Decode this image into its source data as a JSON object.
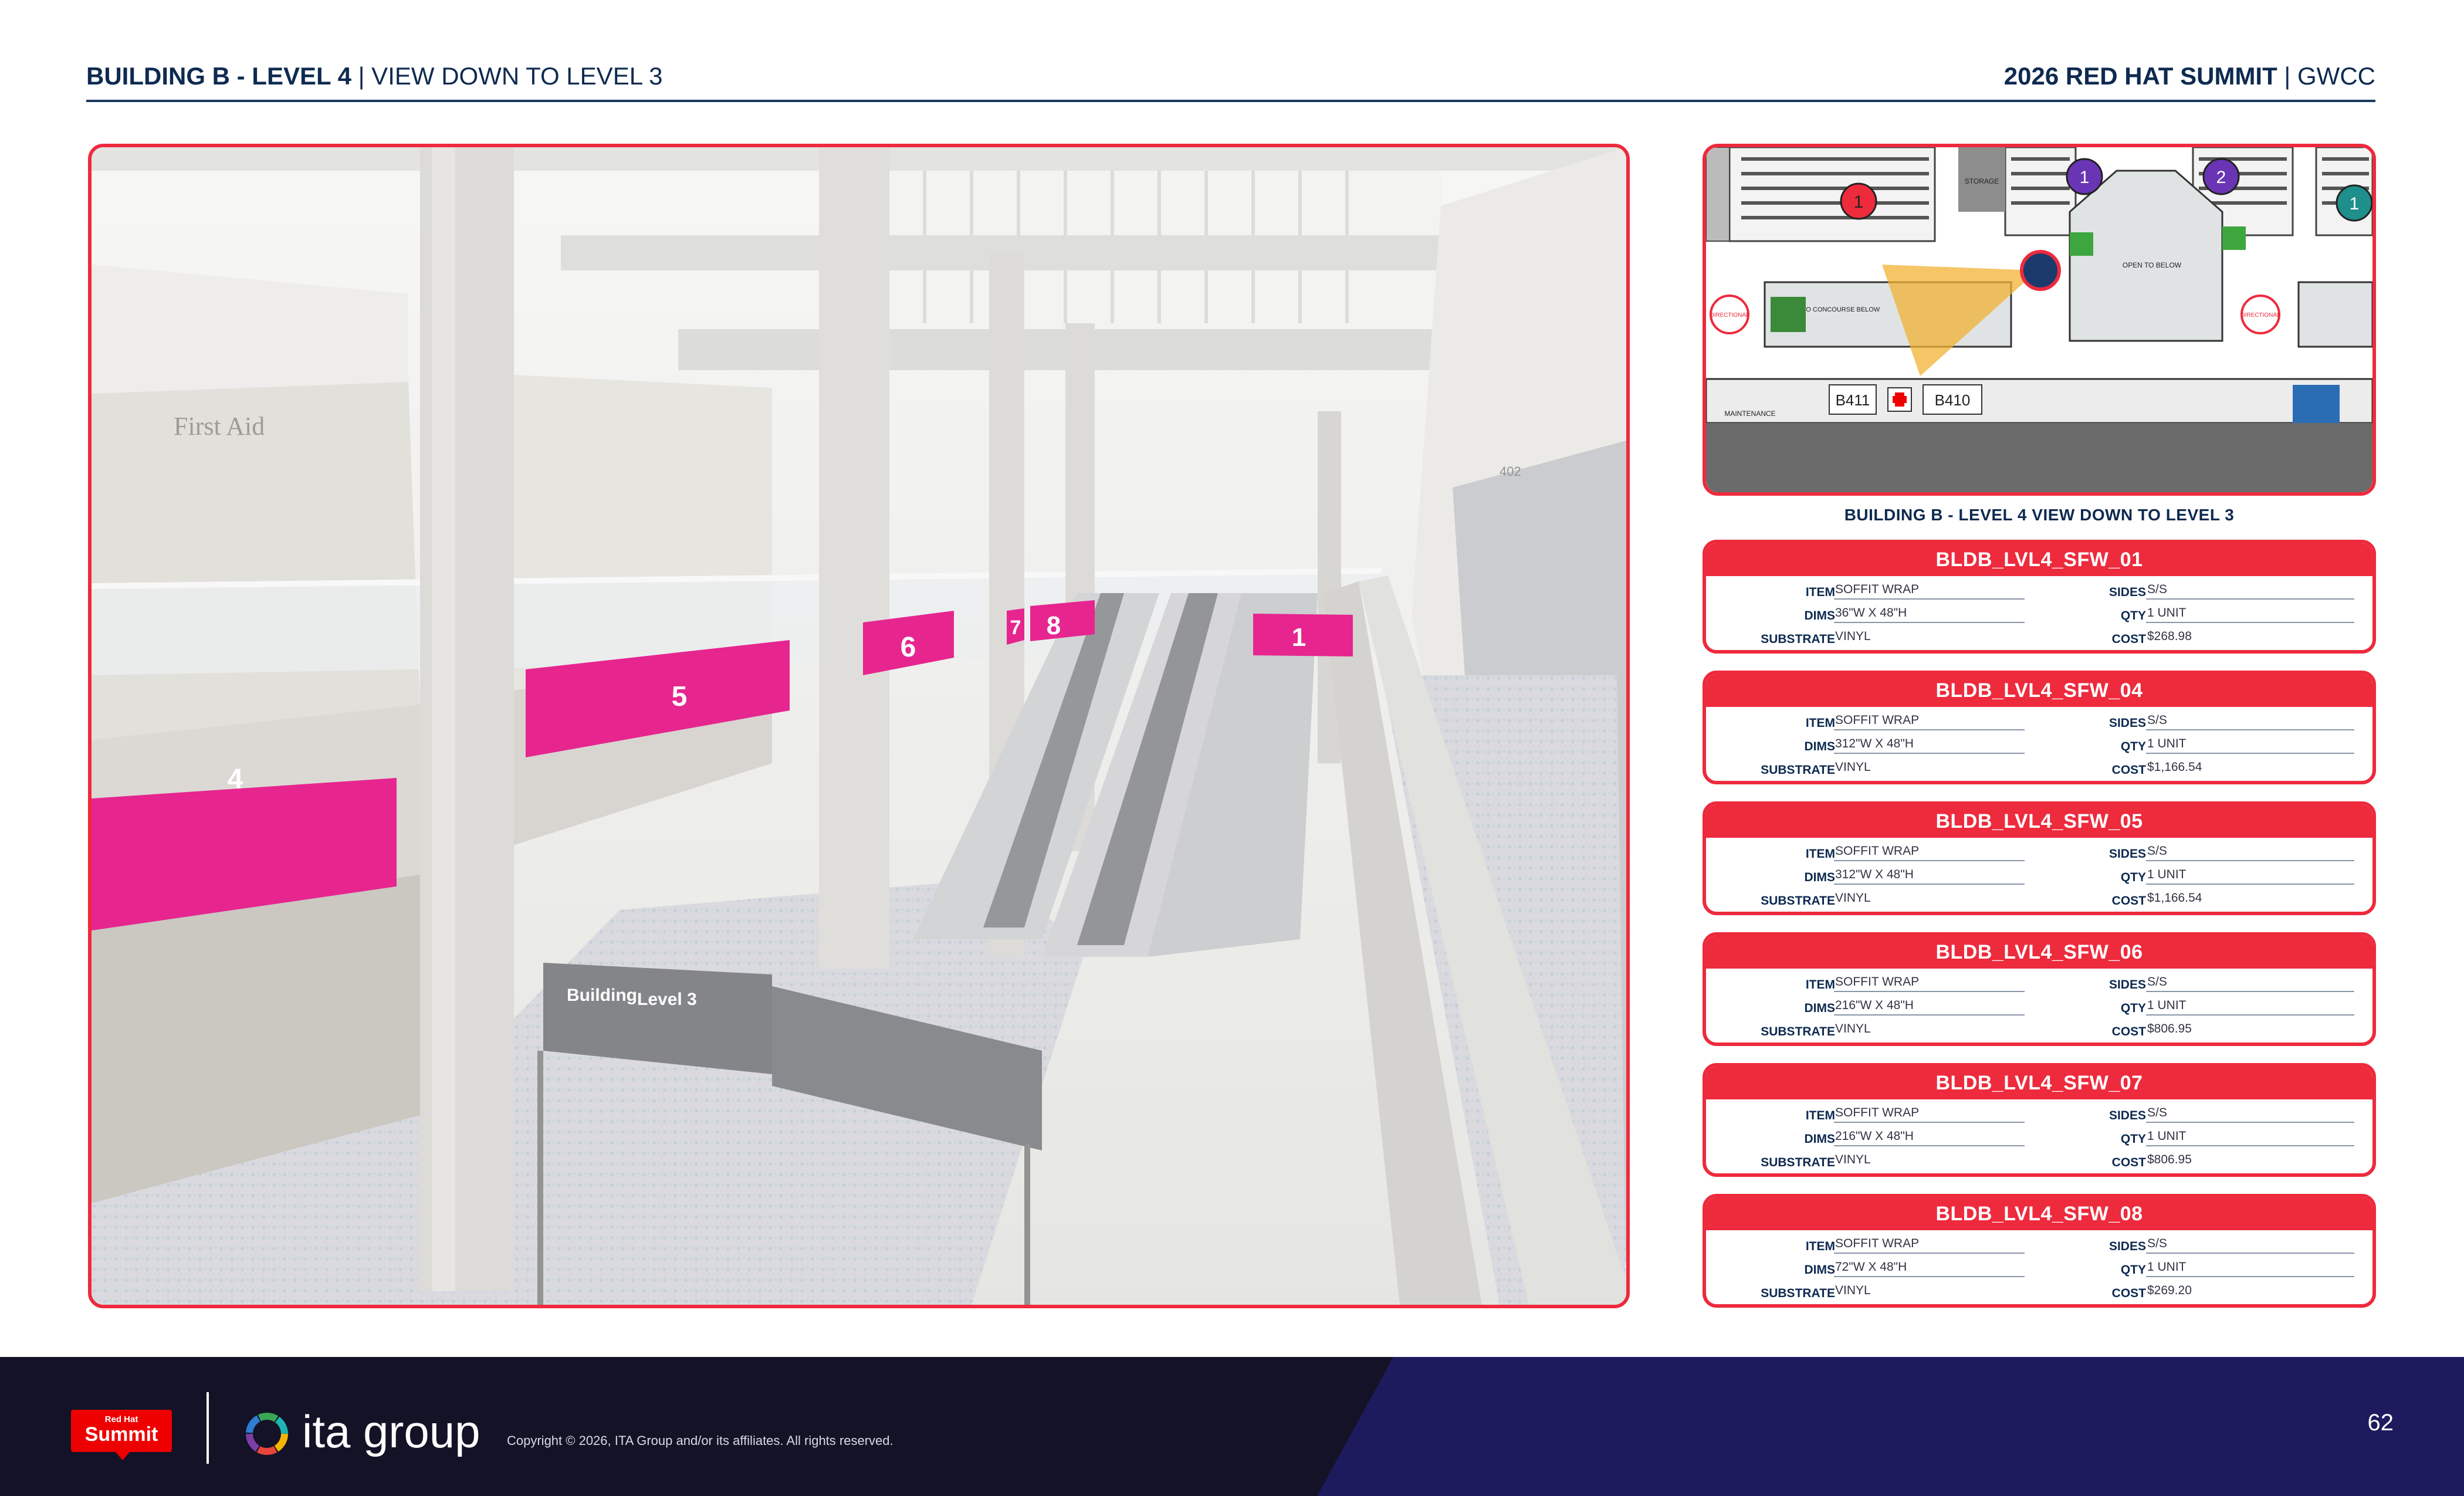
{
  "header": {
    "title_bold": "BUILDING B - LEVEL 4",
    "title_rest": " | VIEW DOWN TO LEVEL 3",
    "event_bold": "2026 RED HAT SUMMIT",
    "event_rest": " | GWCC"
  },
  "photo": {
    "signage": {
      "first_aid": "First Aid",
      "sign_title": "Building",
      "sign_level": "Level 3",
      "room_402": "402"
    },
    "placements": [
      {
        "label": "4"
      },
      {
        "label": "5"
      },
      {
        "label": "6"
      },
      {
        "label": "7"
      },
      {
        "label": "8"
      },
      {
        "label": "1"
      }
    ]
  },
  "plan": {
    "caption": "BUILDING B - LEVEL 4 VIEW DOWN TO LEVEL 3",
    "markers": [
      "1",
      "1",
      "2",
      "1"
    ],
    "room_b411": "B411",
    "room_b410": "B410",
    "maintenance": "MAINTENANCE",
    "storage": "STORAGE",
    "open_to_below": "OPEN TO BELOW",
    "to_concourse_below": "TO CONCOURSE BELOW",
    "directional": "DIRECTIONAL"
  },
  "labels": {
    "item": "ITEM",
    "dims": "DIMS",
    "substrate": "SUBSTRATE",
    "sides": "SIDES",
    "qty": "QTY",
    "cost": "COST"
  },
  "cards": [
    {
      "title": "BLDB_LVL4_SFW_01",
      "item": "SOFFIT WRAP",
      "dims": "36\"W X 48\"H",
      "substrate": "VINYL",
      "sides": "S/S",
      "qty": "1 UNIT",
      "cost": "$268.98"
    },
    {
      "title": "BLDB_LVL4_SFW_04",
      "item": "SOFFIT WRAP",
      "dims": "312\"W X 48\"H",
      "substrate": "VINYL",
      "sides": "S/S",
      "qty": "1 UNIT",
      "cost": "$1,166.54"
    },
    {
      "title": "BLDB_LVL4_SFW_05",
      "item": "SOFFIT WRAP",
      "dims": "312\"W X 48\"H",
      "substrate": "VINYL",
      "sides": "S/S",
      "qty": "1 UNIT",
      "cost": "$1,166.54"
    },
    {
      "title": "BLDB_LVL4_SFW_06",
      "item": "SOFFIT WRAP",
      "dims": "216\"W X 48\"H",
      "substrate": "VINYL",
      "sides": "S/S",
      "qty": "1 UNIT",
      "cost": "$806.95"
    },
    {
      "title": "BLDB_LVL4_SFW_07",
      "item": "SOFFIT WRAP",
      "dims": "216\"W X 48\"H",
      "substrate": "VINYL",
      "sides": "S/S",
      "qty": "1 UNIT",
      "cost": "$806.95"
    },
    {
      "title": "BLDB_LVL4_SFW_08",
      "item": "SOFFIT WRAP",
      "dims": "72\"W X 48\"H",
      "substrate": "VINYL",
      "sides": "S/S",
      "qty": "1 UNIT",
      "cost": "$269.20"
    }
  ],
  "footer": {
    "rh_line1": "Red Hat",
    "rh_line2": "Summit",
    "ita_text": "ita group",
    "copyright": "Copyright © 2026, ITA Group and/or its affiliates. All rights reserved.",
    "page_number": "62"
  },
  "colors": {
    "accent_red": "#ee2a3d",
    "navy": "#0e2a50",
    "magenta": "#e6258f",
    "footer_dark": "#141226",
    "footer_band": "#1e1a5e"
  }
}
